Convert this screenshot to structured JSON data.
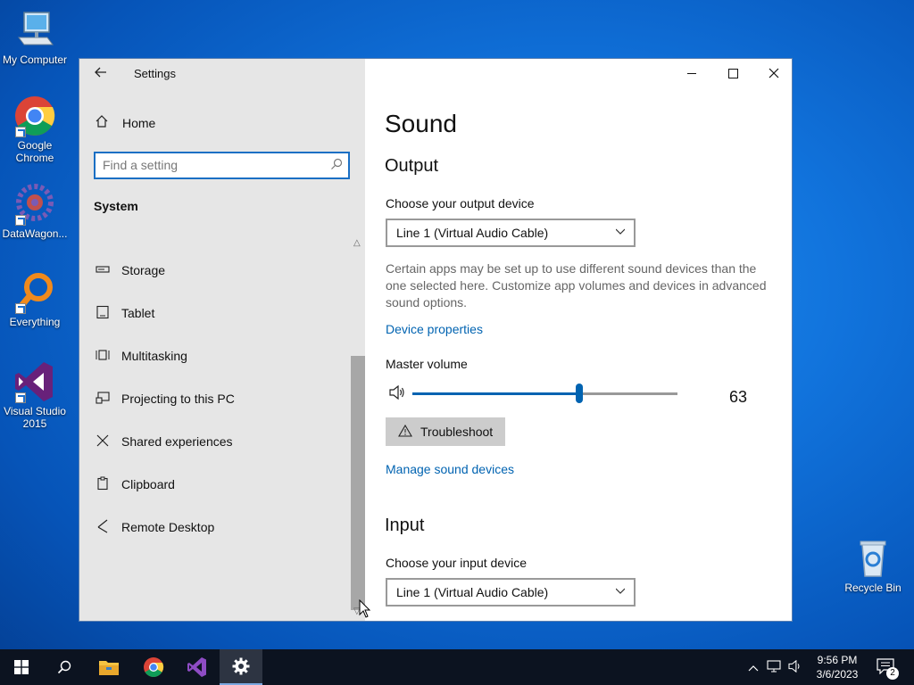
{
  "desktop": {
    "icons": [
      {
        "label": "My Computer"
      },
      {
        "label": "Google Chrome"
      },
      {
        "label": "DataWagon..."
      },
      {
        "label": "Everything"
      },
      {
        "label": "Visual Studio 2015"
      },
      {
        "label": "Recycle Bin"
      }
    ]
  },
  "window": {
    "title": "Settings",
    "sidebar": {
      "home_label": "Home",
      "search_placeholder": "Find a setting",
      "section": "System",
      "items": [
        {
          "label": "Storage",
          "icon": "storage-icon"
        },
        {
          "label": "Tablet",
          "icon": "tablet-icon"
        },
        {
          "label": "Multitasking",
          "icon": "multitasking-icon"
        },
        {
          "label": "Projecting to this PC",
          "icon": "projecting-icon"
        },
        {
          "label": "Shared experiences",
          "icon": "shared-experiences-icon"
        },
        {
          "label": "Clipboard",
          "icon": "clipboard-icon"
        },
        {
          "label": "Remote Desktop",
          "icon": "remote-desktop-icon"
        }
      ]
    },
    "content": {
      "page_title": "Sound",
      "output": {
        "heading": "Output",
        "device_label": "Choose your output device",
        "device_value": "Line 1 (Virtual Audio Cable)",
        "help_text": "Certain apps may be set up to use different sound devices than the one selected here. Customize app volumes and devices in advanced sound options.",
        "device_properties_link": "Device properties",
        "master_volume_label": "Master volume",
        "volume_value": "63",
        "volume_level": 63,
        "troubleshoot_label": "Troubleshoot",
        "manage_link": "Manage sound devices"
      },
      "input": {
        "heading": "Input",
        "device_label": "Choose your input device",
        "device_value": "Line 1 (Virtual Audio Cable)"
      }
    }
  },
  "taskbar": {
    "time": "9:56 PM",
    "date": "3/6/2023",
    "notification_count": "2"
  },
  "colors": {
    "accent": "#0063b1",
    "sidebar_bg": "#e6e6e6",
    "taskbar_bg": "#0c1320"
  }
}
